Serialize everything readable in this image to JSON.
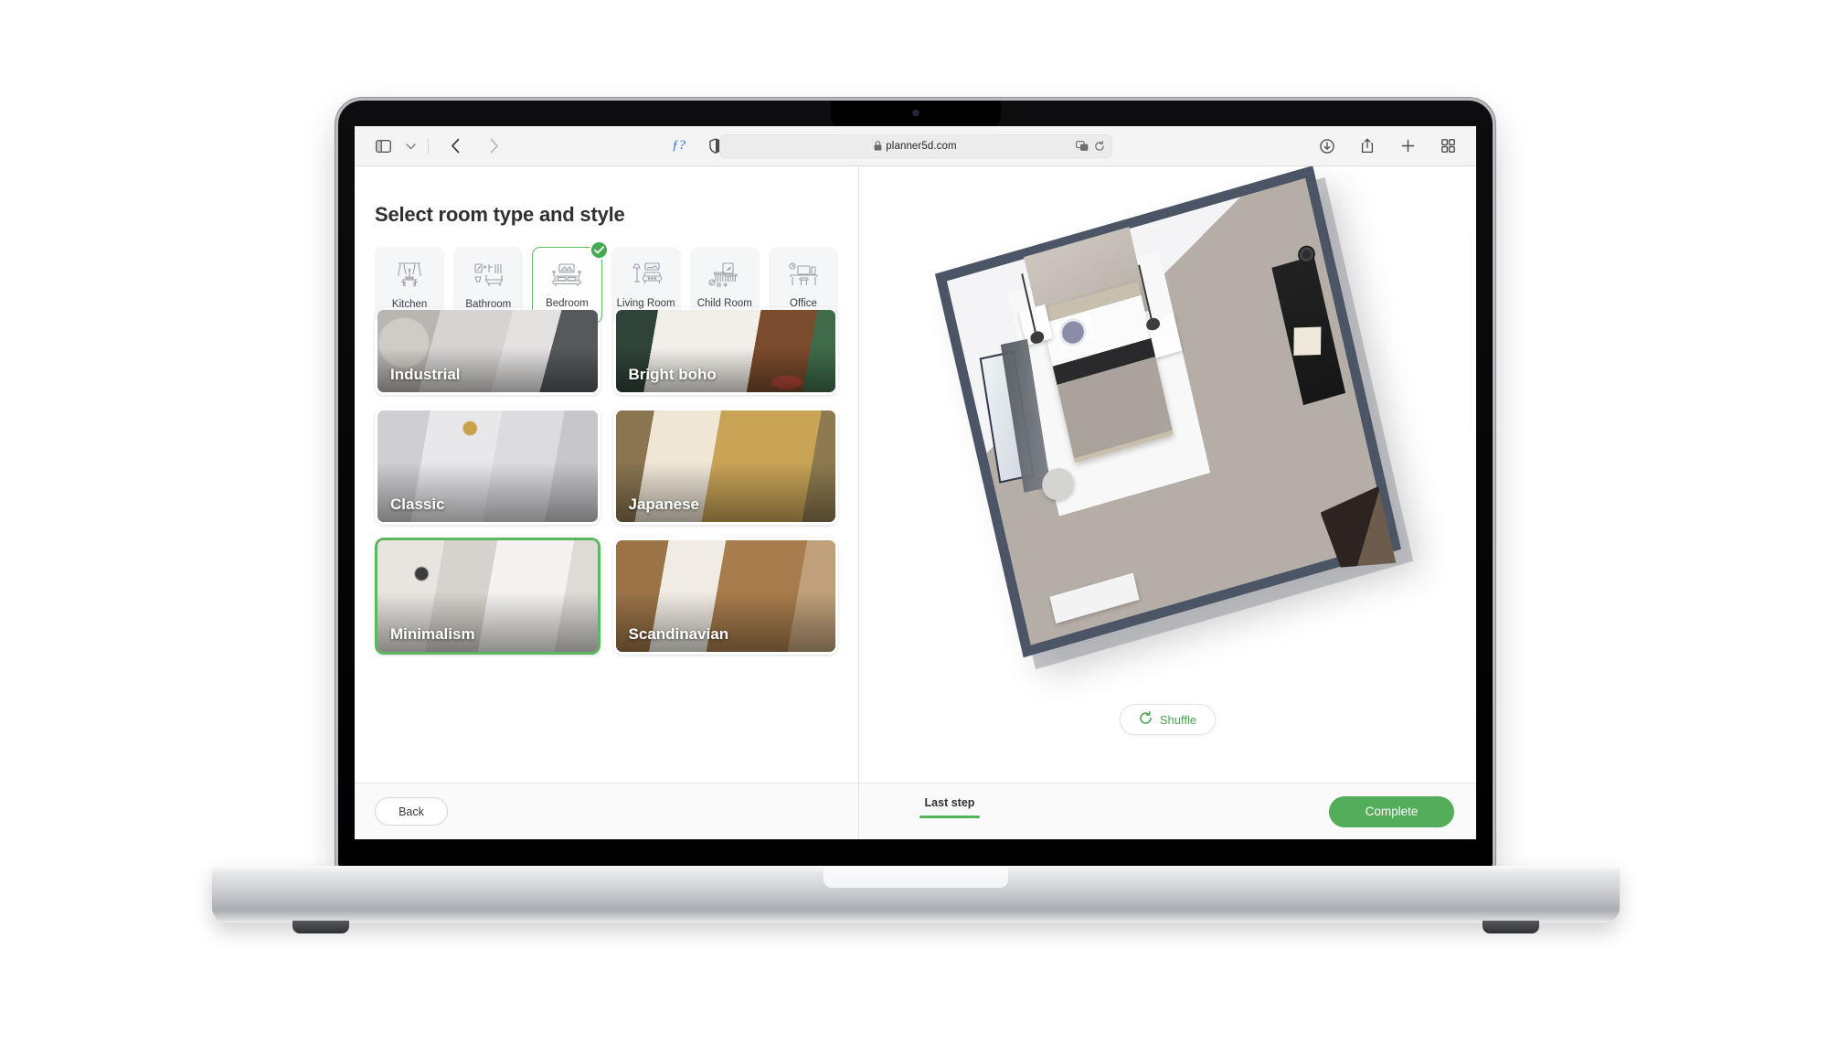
{
  "browser": {
    "url": "planner5d.com",
    "lock_icon": "lock-icon",
    "sidebar_toggle_icon": "sidebar-toggle-icon",
    "tab_dropdown_icon": "chevron-down-icon",
    "back_icon": "chevron-left-icon",
    "forward_icon": "chevron-right-icon",
    "format_label": "ƒ?",
    "reader_icon": "reader-mode-icon",
    "translate_icon": "translate-icon",
    "reload_icon": "reload-icon",
    "downloads_icon": "downloads-icon",
    "share_icon": "share-icon",
    "new_tab_icon": "plus-icon",
    "tab_overview_icon": "tab-overview-icon"
  },
  "page": {
    "title": "Select room type and style"
  },
  "room_types": [
    {
      "label": "Kitchen",
      "icon": "kitchen-icon",
      "selected": false
    },
    {
      "label": "Bathroom",
      "icon": "bathroom-icon",
      "selected": false
    },
    {
      "label": "Bedroom",
      "icon": "bedroom-icon",
      "selected": true
    },
    {
      "label": "Living Room",
      "icon": "living-room-icon",
      "selected": false
    },
    {
      "label": "Child Room",
      "icon": "child-room-icon",
      "selected": false
    },
    {
      "label": "Office",
      "icon": "office-icon",
      "selected": false
    }
  ],
  "styles": [
    {
      "label": "Industrial",
      "selected": false
    },
    {
      "label": "Bright boho",
      "selected": false
    },
    {
      "label": "Classic",
      "selected": false
    },
    {
      "label": "Japanese",
      "selected": false
    },
    {
      "label": "Minimalism",
      "selected": true
    },
    {
      "label": "Scandinavian",
      "selected": false
    }
  ],
  "preview": {
    "shuffle_label": "Shuffle",
    "shuffle_icon": "refresh-icon",
    "room_alt": "3d-bedroom-top-view"
  },
  "footer": {
    "back_label": "Back",
    "step_label": "Last step",
    "complete_label": "Complete"
  },
  "colors": {
    "accent_green": "#53ad5b",
    "shuffle_green": "#4aa455",
    "selected_border": "#5cb85f",
    "check_badge": "#45a94f",
    "panel_bg": "#ffffff",
    "chip_bg": "#f5f6f7",
    "footer_bg": "#fafafa",
    "toolbar_bg": "#f4f4f5",
    "link_blue": "#2d6ee8"
  }
}
